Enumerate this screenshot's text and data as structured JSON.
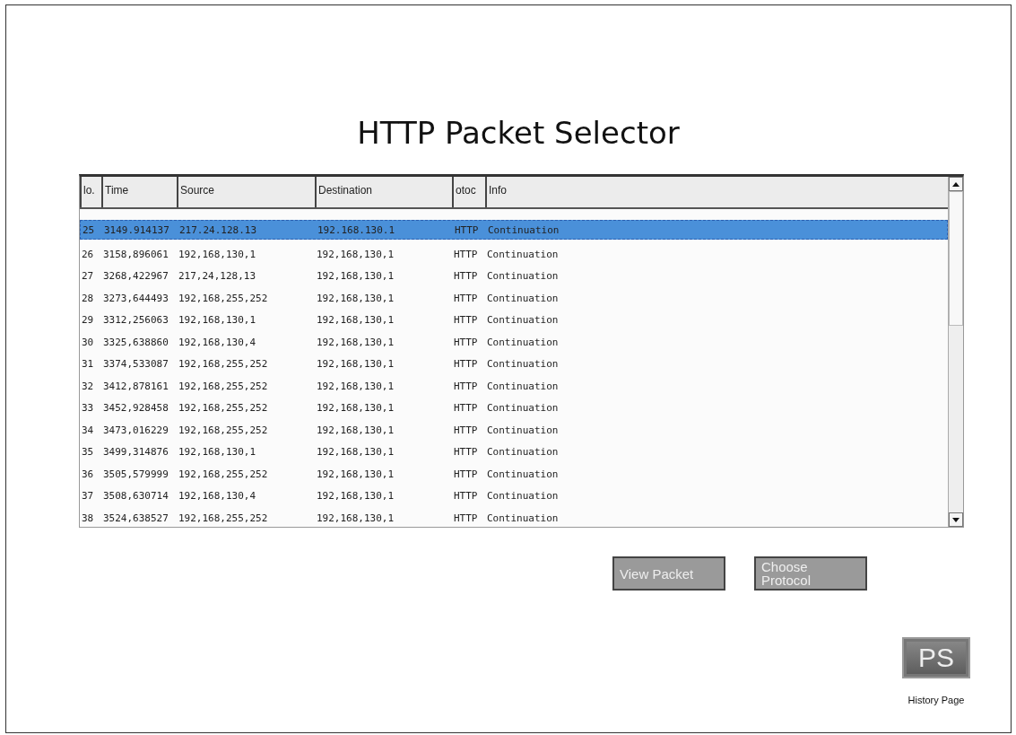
{
  "title": "HTTP Packet Selector",
  "table": {
    "columns": [
      "lo.",
      "Time",
      "Source",
      "Destination",
      "otoc",
      "Info"
    ],
    "rows": [
      {
        "cells": [
          "25",
          "3149.914137",
          "217.24.128.13",
          "192.168.130.1",
          "HTTP",
          "Continuation"
        ],
        "selected": true
      },
      {
        "cells": [
          "26",
          "3158,896061",
          "192,168,130,1",
          "192,168,130,1",
          "HTTP",
          "Continuation"
        ],
        "selected": false
      },
      {
        "cells": [
          "27",
          "3268,422967",
          "217,24,128,13",
          "192,168,130,1",
          "HTTP",
          "Continuation"
        ],
        "selected": false
      },
      {
        "cells": [
          "28",
          "3273,644493",
          "192,168,255,252",
          "192,168,130,1",
          "HTTP",
          "Continuation"
        ],
        "selected": false
      },
      {
        "cells": [
          "29",
          "3312,256063",
          "192,168,130,1",
          "192,168,130,1",
          "HTTP",
          "Continuation"
        ],
        "selected": false
      },
      {
        "cells": [
          "30",
          "3325,638860",
          "192,168,130,4",
          "192,168,130,1",
          "HTTP",
          "Continuation"
        ],
        "selected": false
      },
      {
        "cells": [
          "31",
          "3374,533087",
          "192,168,255,252",
          "192,168,130,1",
          "HTTP",
          "Continuation"
        ],
        "selected": false
      },
      {
        "cells": [
          "32",
          "3412,878161",
          "192,168,255,252",
          "192,168,130,1",
          "HTTP",
          "Continuation"
        ],
        "selected": false
      },
      {
        "cells": [
          "33",
          "3452,928458",
          "192,168,255,252",
          "192,168,130,1",
          "HTTP",
          "Continuation"
        ],
        "selected": false
      },
      {
        "cells": [
          "34",
          "3473,016229",
          "192,168,255,252",
          "192,168,130,1",
          "HTTP",
          "Continuation"
        ],
        "selected": false
      },
      {
        "cells": [
          "35",
          "3499,314876",
          "192,168,130,1",
          "192,168,130,1",
          "HTTP",
          "Continuation"
        ],
        "selected": false
      },
      {
        "cells": [
          "36",
          "3505,579999",
          "192,168,255,252",
          "192,168,130,1",
          "HTTP",
          "Continuation"
        ],
        "selected": false
      },
      {
        "cells": [
          "37",
          "3508,630714",
          "192,168,130,4",
          "192,168,130,1",
          "HTTP",
          "Continuation"
        ],
        "selected": false
      },
      {
        "cells": [
          "38",
          "3524,638527",
          "192,168,255,252",
          "192,168,130,1",
          "HTTP",
          "Continuation"
        ],
        "selected": false
      }
    ]
  },
  "buttons": [
    "View Packet",
    "Choose Protocol"
  ],
  "history_link": {
    "icon_text": "PS",
    "label": "History Page"
  }
}
